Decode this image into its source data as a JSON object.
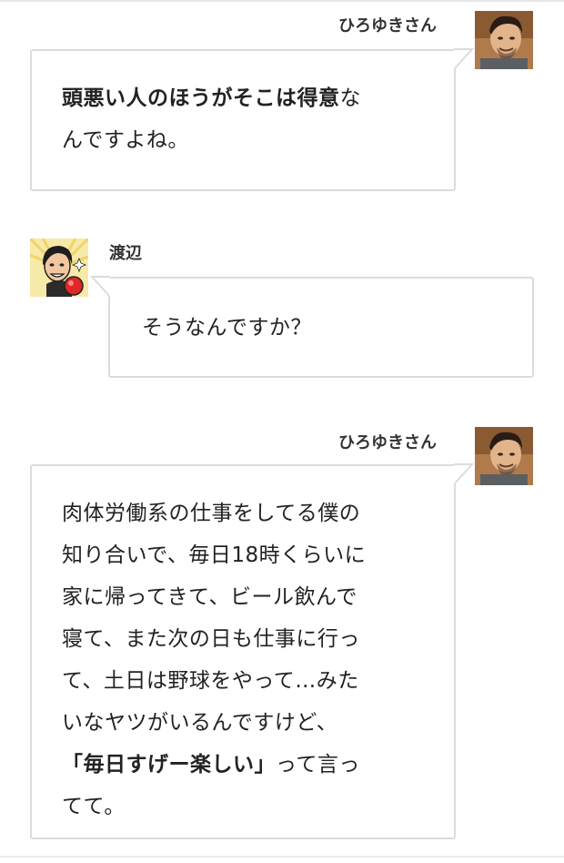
{
  "conversation": {
    "messages": [
      {
        "speaker": "ひろゆきさん",
        "avatar_icon": "hiroyuki-photo-avatar",
        "lines": [
          [
            {
              "text": "頭悪い人のほうがそこは得意",
              "bold": true
            },
            {
              "text": "な",
              "bold": false
            }
          ],
          [
            {
              "text": "んですよね。",
              "bold": false
            }
          ]
        ]
      },
      {
        "speaker": "渡辺",
        "avatar_icon": "watanabe-illustrated-avatar",
        "lines": [
          [
            {
              "text": "そうなんですか？",
              "bold": false
            }
          ]
        ]
      },
      {
        "speaker": "ひろゆきさん",
        "avatar_icon": "hiroyuki-photo-avatar",
        "lines": [
          [
            {
              "text": "肉体労働系の仕事をしてる僕の",
              "bold": false
            }
          ],
          [
            {
              "text": "知り合いで、毎日18時くらいに",
              "bold": false
            }
          ],
          [
            {
              "text": "家に帰ってきて、ビール飲んで",
              "bold": false
            }
          ],
          [
            {
              "text": "寝て、また次の日も仕事に行っ",
              "bold": false
            }
          ],
          [
            {
              "text": "て、土日は野球をやって…みた",
              "bold": false
            }
          ],
          [
            {
              "text": "いなヤツがいるんですけど、",
              "bold": false
            }
          ],
          [
            {
              "text": "「毎日すげー楽しい」",
              "bold": true
            },
            {
              "text": "って言っ",
              "bold": false
            }
          ],
          [
            {
              "text": "てて。",
              "bold": false
            }
          ]
        ]
      }
    ]
  },
  "colors": {
    "bubble_border": "#dcdcdc",
    "text": "#222222",
    "name_text": "#333333"
  }
}
